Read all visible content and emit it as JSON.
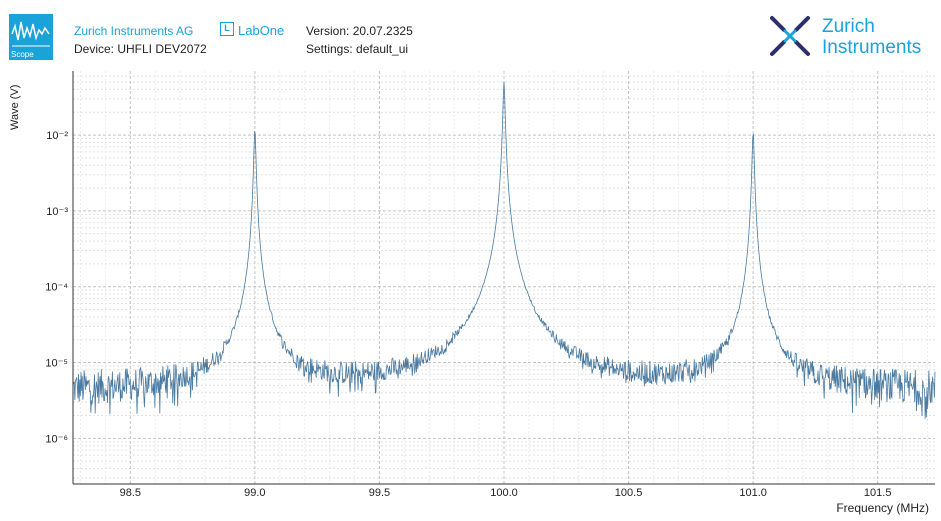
{
  "header": {
    "module_label": "Scope",
    "company": "Zurich Instruments AG",
    "device": "Device: UHFLI DEV2072",
    "product": "LabOne",
    "product_badge": "L",
    "version": "Version: 20.07.2325",
    "settings": "Settings: default_ui",
    "brand_line1": "Zurich",
    "brand_line2": "Instruments",
    "accent_color": "#1aa3d9",
    "brand_logo_color": "#2b2f6b"
  },
  "chart_data": {
    "type": "line",
    "title": "",
    "xlabel": "Frequency (MHz)",
    "ylabel": "Wave (V)",
    "xlim": [
      98.27,
      101.73
    ],
    "ylim": [
      2.5e-07,
      0.07
    ],
    "yscale": "log",
    "grid": true,
    "series_color": "#4a7aa0",
    "x_ticks": [
      98.5,
      99.0,
      99.5,
      100.0,
      100.5,
      101.0,
      101.5
    ],
    "x_tick_labels": [
      "98.5",
      "99.0",
      "99.5",
      "100.0",
      "100.5",
      "101.0",
      "101.5"
    ],
    "y_ticks": [
      1e-06,
      1e-05,
      0.0001,
      0.001,
      0.01
    ],
    "y_tick_labels": [
      "10⁻⁶",
      "10⁻⁵",
      "10⁻⁴",
      "10⁻³",
      "10⁻²"
    ],
    "series": [
      {
        "noise_floor": 4e-06,
        "peaks": [
          {
            "x": 99.0,
            "y": 0.012
          },
          {
            "x": 100.0,
            "y": 0.05
          },
          {
            "x": 101.0,
            "y": 0.011
          }
        ]
      }
    ]
  }
}
